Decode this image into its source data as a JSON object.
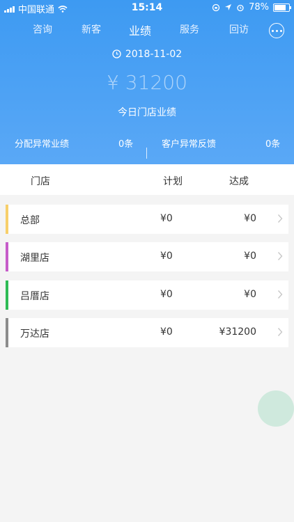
{
  "status_bar": {
    "carrier": "中国联通",
    "time": "15:14",
    "battery": "78%"
  },
  "tabs": [
    {
      "label": "咨询",
      "active": false
    },
    {
      "label": "新客",
      "active": false
    },
    {
      "label": "业绩",
      "active": true
    },
    {
      "label": "服务",
      "active": false
    },
    {
      "label": "回访",
      "active": false
    }
  ],
  "more_icon": "more-dots-icon",
  "summary": {
    "date": "2018-11-02",
    "amount": "¥ 31200",
    "amount_label": "今日门店业绩",
    "abnormal_performance_label": "分配异常业绩",
    "abnormal_performance_value": "0条",
    "abnormal_feedback_label": "客户异常反馈",
    "abnormal_feedback_value": "0条"
  },
  "table": {
    "headers": {
      "store": "门店",
      "plan": "计划",
      "achieved": "达成"
    },
    "rows": [
      {
        "store": "总部",
        "plan": "¥0",
        "achieved": "¥0",
        "color": "#f7cf6a"
      },
      {
        "store": "湖里店",
        "plan": "¥0",
        "achieved": "¥0",
        "color": "#c65cc9"
      },
      {
        "store": "吕厝店",
        "plan": "¥0",
        "achieved": "¥0",
        "color": "#2ebb55"
      },
      {
        "store": "万达店",
        "plan": "¥0",
        "achieved": "¥31200",
        "color": "#8c8c8c"
      }
    ]
  },
  "colors": {
    "header_blue": "#4aa1f4",
    "fab": "#cfe9dd"
  }
}
